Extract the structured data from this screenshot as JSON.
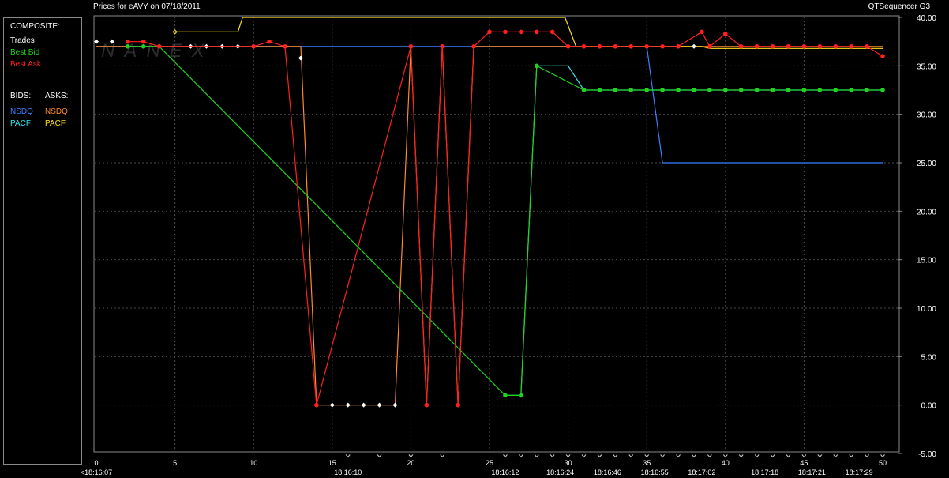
{
  "header": {
    "title": "Prices for  eAVY  on  07/18/2011",
    "app_name": "QTSequencer G3"
  },
  "legend": {
    "composite_label": "COMPOSITE:",
    "trades": {
      "label": "Trades",
      "color": "#ffffff"
    },
    "best_bid": {
      "label": "Best Bid",
      "color": "#1fd31f"
    },
    "best_ask": {
      "label": "Best Ask",
      "color": "#ff2020"
    },
    "bids_label": "BIDS:",
    "asks_label": "ASKS:",
    "bids": [
      {
        "label": "NSDQ",
        "color": "#3a7fff"
      },
      {
        "label": "PACF",
        "color": "#38e8f0"
      }
    ],
    "asks": [
      {
        "label": "NSDQ",
        "color": "#ff8a2a"
      },
      {
        "label": "PACF",
        "color": "#ffe020"
      }
    ]
  },
  "watermark": "NANEX",
  "chart_data": {
    "type": "line",
    "background": "#000000",
    "grid_color": "#4a4a4a",
    "y_axis": {
      "range": [
        -5,
        40
      ],
      "ticks": [
        40,
        35,
        30,
        25,
        20,
        15,
        10,
        5,
        0,
        -5
      ],
      "tick_labels": [
        "40.00",
        "35.00",
        "30.00",
        "25.00",
        "20.00",
        "15.00",
        "10.00",
        "5.00",
        "0.00",
        "-5.00"
      ]
    },
    "x_axis": {
      "range": [
        0,
        50
      ],
      "ticks": [
        0,
        5,
        10,
        15,
        20,
        25,
        30,
        35,
        40,
        45,
        50
      ],
      "tick_labels": [
        "0",
        "5",
        "10",
        "15",
        "20",
        "25",
        "30",
        "35",
        "40",
        "45",
        "50"
      ],
      "time_labels": [
        {
          "at": 0,
          "label": "<18:16:07"
        },
        {
          "at": 16,
          "label": "18:16:10"
        },
        {
          "at": 26,
          "label": "18:16:12"
        },
        {
          "at": 29.5,
          "label": "18:16:24"
        },
        {
          "at": 32.5,
          "label": "18:16:46"
        },
        {
          "at": 35.5,
          "label": "18:16:55"
        },
        {
          "at": 38.5,
          "label": "18:17:02"
        },
        {
          "at": 42.5,
          "label": "18:17:18"
        },
        {
          "at": 45.5,
          "label": "18:17:21"
        },
        {
          "at": 48.5,
          "label": "18:17:29"
        }
      ],
      "gap_markers": [
        16,
        18,
        20,
        22,
        26,
        27,
        28,
        29,
        30,
        31,
        32,
        33,
        34,
        35,
        36,
        37,
        38,
        39,
        40,
        41,
        42,
        43,
        44,
        45,
        46,
        47,
        48,
        49,
        50
      ]
    },
    "series": [
      {
        "name": "NSDQ",
        "side": "bid",
        "color": "#3a7fff",
        "points": [
          [
            0,
            37
          ],
          [
            35,
            37
          ],
          [
            36,
            25
          ],
          [
            50,
            25
          ]
        ]
      },
      {
        "name": "PACF",
        "side": "bid",
        "color": "#38e8f0",
        "points": [
          [
            26,
            1
          ],
          [
            27,
            1
          ],
          [
            28,
            35
          ],
          [
            30,
            35
          ],
          [
            31,
            32.5
          ],
          [
            50,
            32.5
          ]
        ]
      },
      {
        "name": "NSDQ",
        "side": "ask",
        "color": "#ff8a2a",
        "points": [
          [
            0,
            37
          ],
          [
            13,
            37
          ],
          [
            14,
            0
          ],
          [
            19,
            0
          ],
          [
            20,
            37
          ],
          [
            21,
            0
          ],
          [
            22,
            37
          ],
          [
            23,
            0
          ],
          [
            24,
            37
          ],
          [
            26,
            37
          ],
          [
            50,
            37
          ]
        ]
      },
      {
        "name": "PACF",
        "side": "ask",
        "color": "#ffe020",
        "points": [
          [
            5,
            38.5
          ],
          [
            9,
            38.5
          ],
          [
            9.3,
            40
          ],
          [
            29.8,
            40
          ],
          [
            30.5,
            37
          ],
          [
            37,
            37
          ],
          [
            38.5,
            37
          ],
          [
            39,
            36.8
          ],
          [
            50,
            36.8
          ]
        ]
      },
      {
        "name": "Trades",
        "color": "#ffffff",
        "marker_only": true,
        "points": [
          [
            0,
            37.5
          ],
          [
            1,
            37.5
          ],
          [
            6,
            37
          ],
          [
            7,
            37
          ],
          [
            8,
            37
          ],
          [
            9,
            37
          ],
          [
            10,
            37
          ],
          [
            13,
            35.8
          ],
          [
            15,
            0
          ],
          [
            16,
            0
          ],
          [
            17,
            0
          ],
          [
            18,
            0
          ],
          [
            19,
            0
          ],
          [
            38,
            37
          ]
        ]
      },
      {
        "name": "Best Bid",
        "color": "#1fd31f",
        "points": [
          [
            2,
            37
          ],
          [
            3,
            37
          ],
          [
            4,
            37
          ],
          [
            26,
            1
          ],
          [
            27,
            1
          ],
          [
            28,
            35
          ],
          [
            31,
            32.5
          ],
          [
            32,
            32.5
          ],
          [
            33,
            32.5
          ],
          [
            34,
            32.5
          ],
          [
            35,
            32.5
          ],
          [
            36,
            32.5
          ],
          [
            37,
            32.5
          ],
          [
            38,
            32.5
          ],
          [
            39,
            32.5
          ],
          [
            40,
            32.5
          ],
          [
            41,
            32.5
          ],
          [
            42,
            32.5
          ],
          [
            43,
            32.5
          ],
          [
            44,
            32.5
          ],
          [
            45,
            32.5
          ],
          [
            46,
            32.5
          ],
          [
            47,
            32.5
          ],
          [
            48,
            32.5
          ],
          [
            49,
            32.5
          ],
          [
            50,
            32.5
          ]
        ]
      },
      {
        "name": "Best Ask",
        "color": "#ff2020",
        "points": [
          [
            2,
            37.5
          ],
          [
            3,
            37.5
          ],
          [
            4,
            37
          ],
          [
            10,
            37
          ],
          [
            11,
            37.5
          ],
          [
            12,
            37
          ],
          [
            14,
            0
          ],
          [
            20,
            37
          ],
          [
            21,
            0
          ],
          [
            22,
            37
          ],
          [
            23,
            0
          ],
          [
            24,
            37
          ],
          [
            25,
            38.5
          ],
          [
            26,
            38.5
          ],
          [
            27,
            38.5
          ],
          [
            28,
            38.5
          ],
          [
            29,
            38.5
          ],
          [
            30,
            37
          ],
          [
            31,
            37
          ],
          [
            32,
            37
          ],
          [
            33,
            37
          ],
          [
            34,
            37
          ],
          [
            35,
            37
          ],
          [
            36,
            37
          ],
          [
            37,
            37
          ],
          [
            38.5,
            38.5
          ],
          [
            39,
            37
          ],
          [
            40,
            38.3
          ],
          [
            41,
            37
          ],
          [
            42,
            37
          ],
          [
            43,
            37
          ],
          [
            44,
            37
          ],
          [
            45,
            37
          ],
          [
            46,
            37
          ],
          [
            47,
            37
          ],
          [
            48,
            37
          ],
          [
            49,
            37
          ],
          [
            50,
            36
          ]
        ]
      }
    ]
  }
}
